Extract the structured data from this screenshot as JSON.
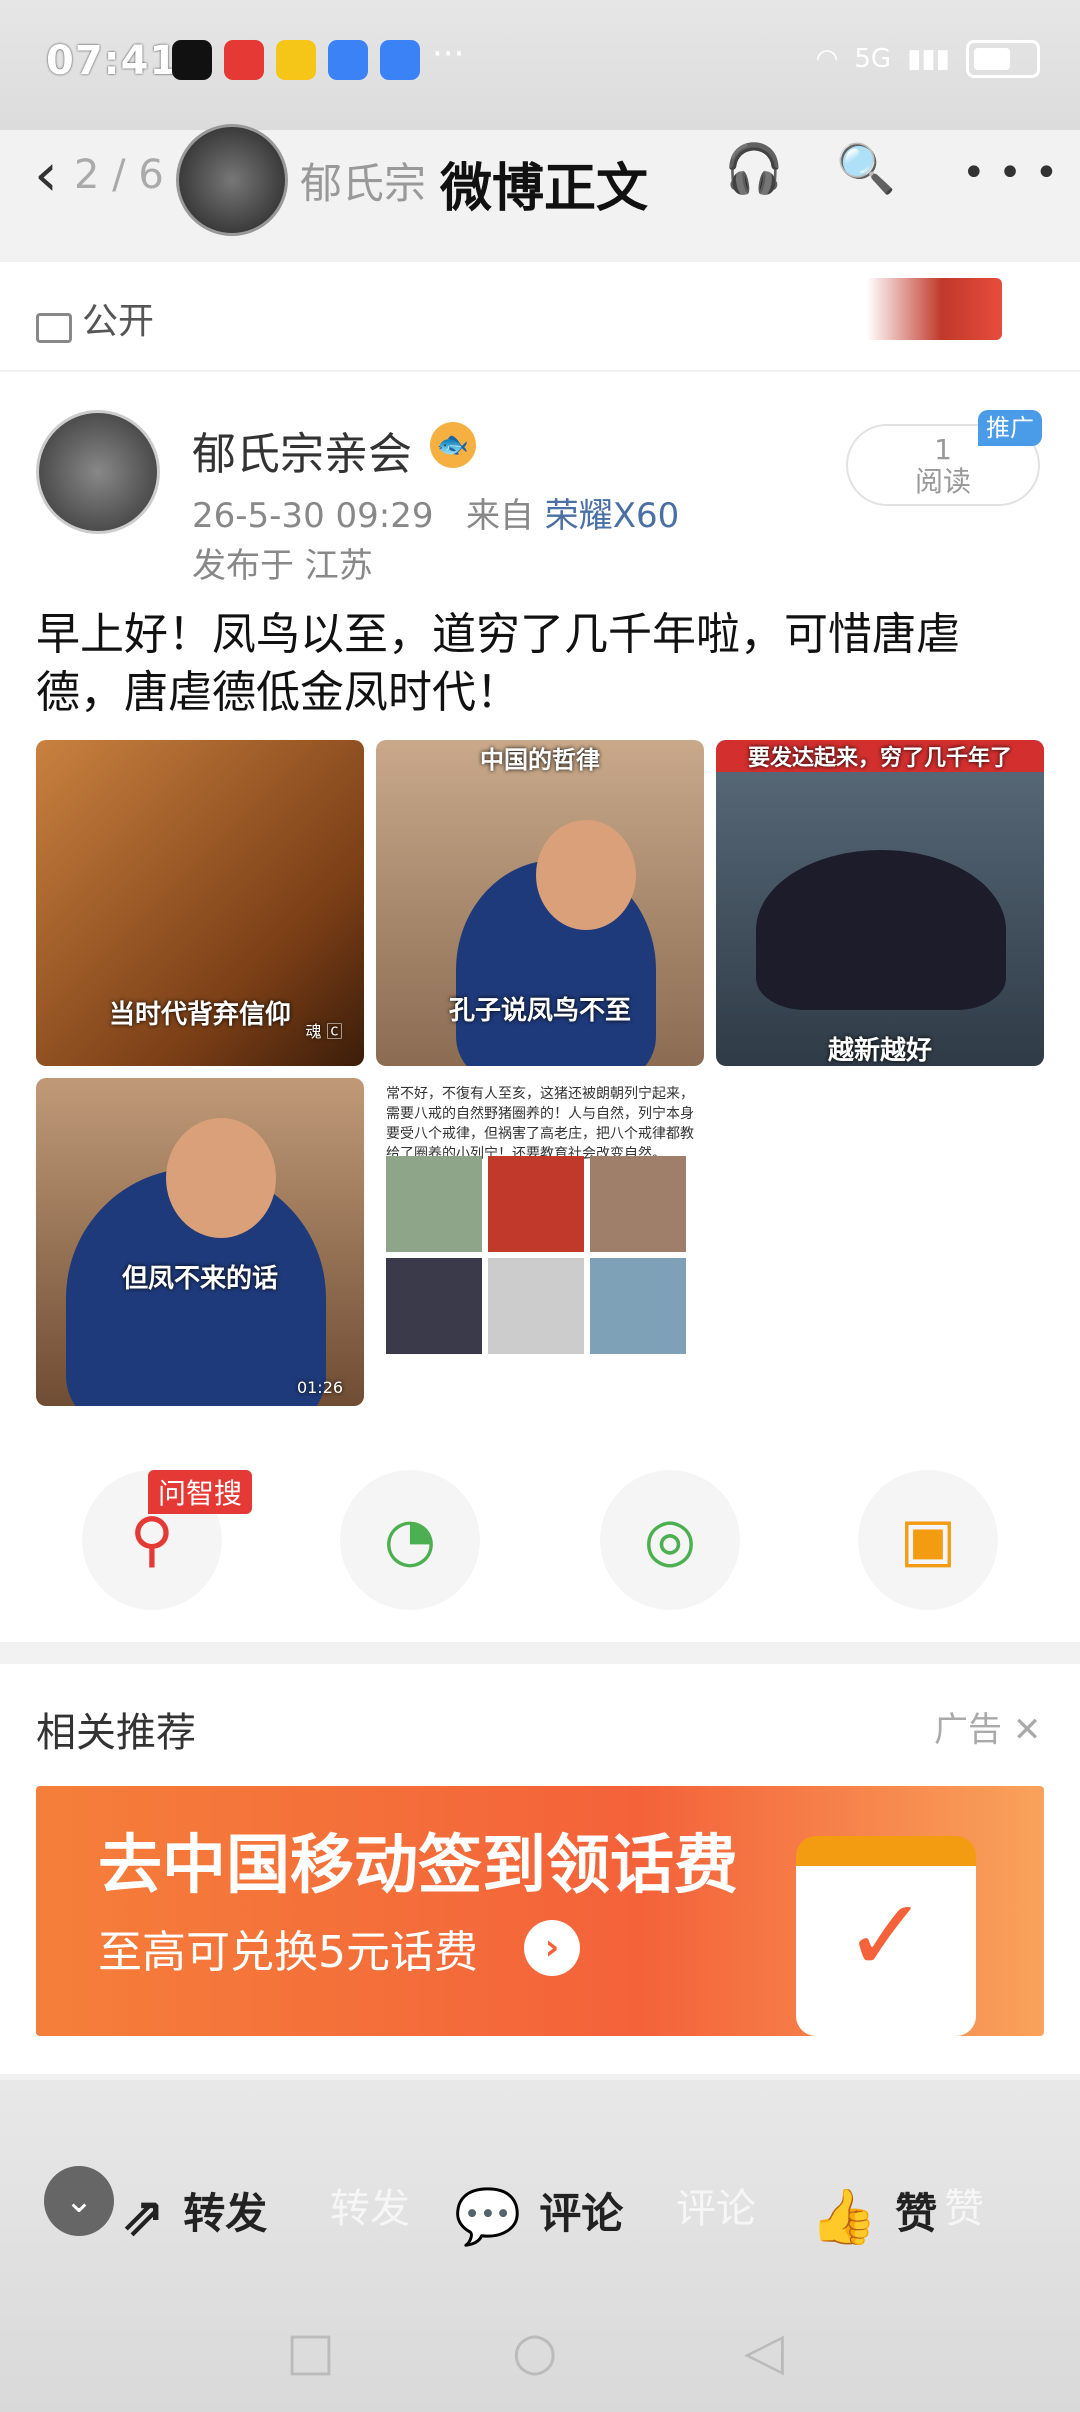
{
  "status": {
    "time": "07:41",
    "more": "···",
    "network": "5G"
  },
  "header": {
    "page_indicator": "2 / 6",
    "author_short": "郁氏宗",
    "title": "微博正文",
    "listen_label": "听"
  },
  "post": {
    "visibility": "公开",
    "author": "郁氏宗亲会",
    "time": "26-5-30 09:29",
    "source_prefix": "来自",
    "device": "荣耀X60",
    "location": "发布于 江苏",
    "read_count": "1",
    "read_label": "阅读",
    "promo_badge": "推广",
    "text": "早上好！凤鸟以至，道穷了几千年啦，可惜唐虐德，唐虐德低金凤时代！",
    "images": [
      {
        "caption": "当时代背弃信仰",
        "watermark": "魂 🄲"
      },
      {
        "top_caption": "中国的哲律",
        "caption": "孔子说凤鸟不至"
      },
      {
        "top_caption": "要发达起来，穷了几千年了",
        "caption": "越新越好"
      },
      {
        "caption": "但凤不来的话",
        "duration": "01:26"
      },
      {
        "text": "常不好，不復有人至亥，这猪还被朗朝列宁起来，需要八戒的自然野猪圈养的！人与自然，列宁本身要受八个戒律，但祸害了高老庄，把八个戒律都教给了圈养的小列宁！还要教育社会改变自然。"
      }
    ],
    "actions": {
      "zhisou_badge": "问智搜"
    }
  },
  "recommend": {
    "title": "相关推荐",
    "ad_tag": "广告",
    "ad_title": "去中国移动签到领话费",
    "ad_subtitle": "至高可兑换5元话费",
    "ad_arrow": "›"
  },
  "bottom": {
    "repost": "转发",
    "comment": "评论",
    "like": "赞",
    "ghost_repost": "转发",
    "ghost_comment": "评论",
    "ghost_like": "赞"
  }
}
